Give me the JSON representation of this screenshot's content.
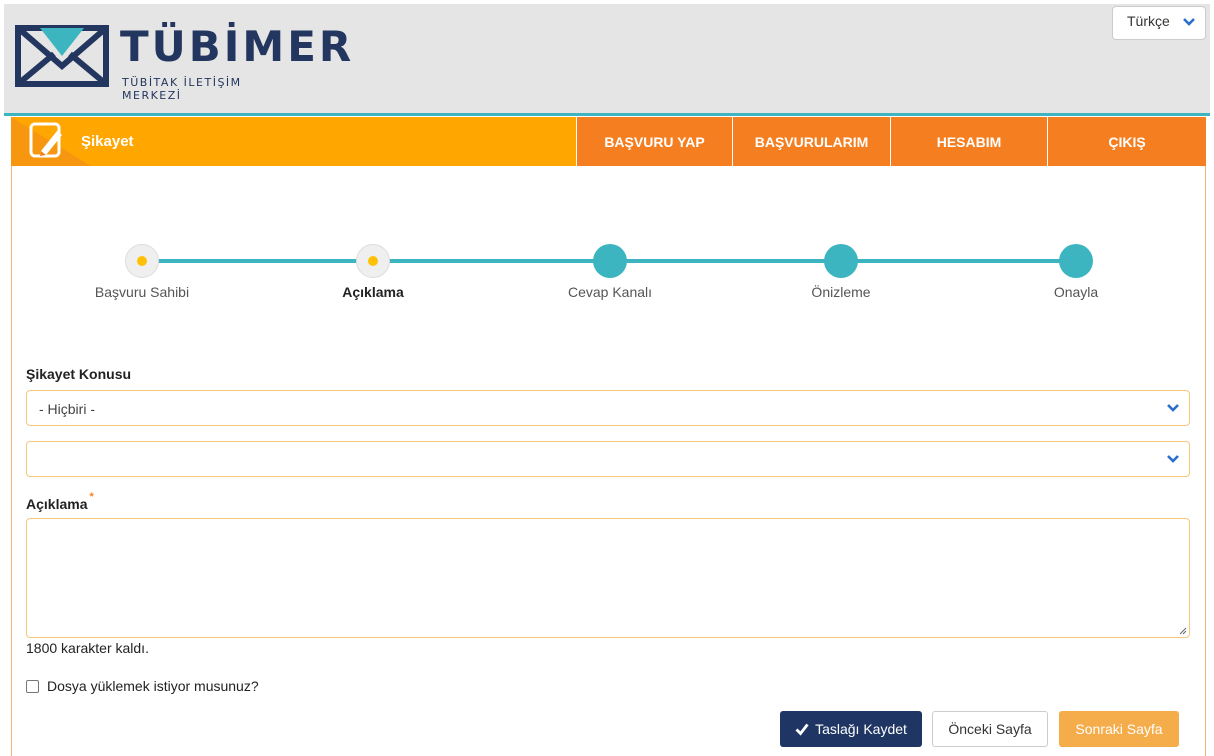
{
  "brand": {
    "name": "TÜBİMER",
    "subtitle": "TÜBİTAK İLETİŞİM MERKEZİ"
  },
  "language": {
    "selected": "Türkçe"
  },
  "nav": {
    "page_title": "Şikayet",
    "items": [
      {
        "label": "BAŞVURU YAP"
      },
      {
        "label": "BAŞVURULARIM"
      },
      {
        "label": "HESABIM"
      },
      {
        "label": "ÇIKIŞ"
      }
    ]
  },
  "stepper": {
    "steps": [
      {
        "label": "Başvuru Sahibi",
        "state": "done"
      },
      {
        "label": "Açıklama",
        "state": "active"
      },
      {
        "label": "Cevap Kanalı",
        "state": "todo"
      },
      {
        "label": "Önizleme",
        "state": "todo"
      },
      {
        "label": "Onayla",
        "state": "todo"
      }
    ]
  },
  "form": {
    "topic_label": "Şikayet Konusu",
    "topic_value": "- Hiçbiri -",
    "subtopic_value": "",
    "description_label": "Açıklama",
    "required_mark": "*",
    "description_value": "",
    "char_count": "1800 karakter kaldı.",
    "upload_label": "Dosya yüklemek istiyor musunuz?"
  },
  "actions": {
    "save_draft": "Taslağı Kaydet",
    "previous": "Önceki Sayfa",
    "next": "Sonraki Sayfa"
  },
  "colors": {
    "brand_navy": "#23365f",
    "accent_orange": "#f57f20",
    "bar_orange": "#ffa600",
    "teal": "#3db5c0",
    "step_yellow": "#ffc107"
  }
}
